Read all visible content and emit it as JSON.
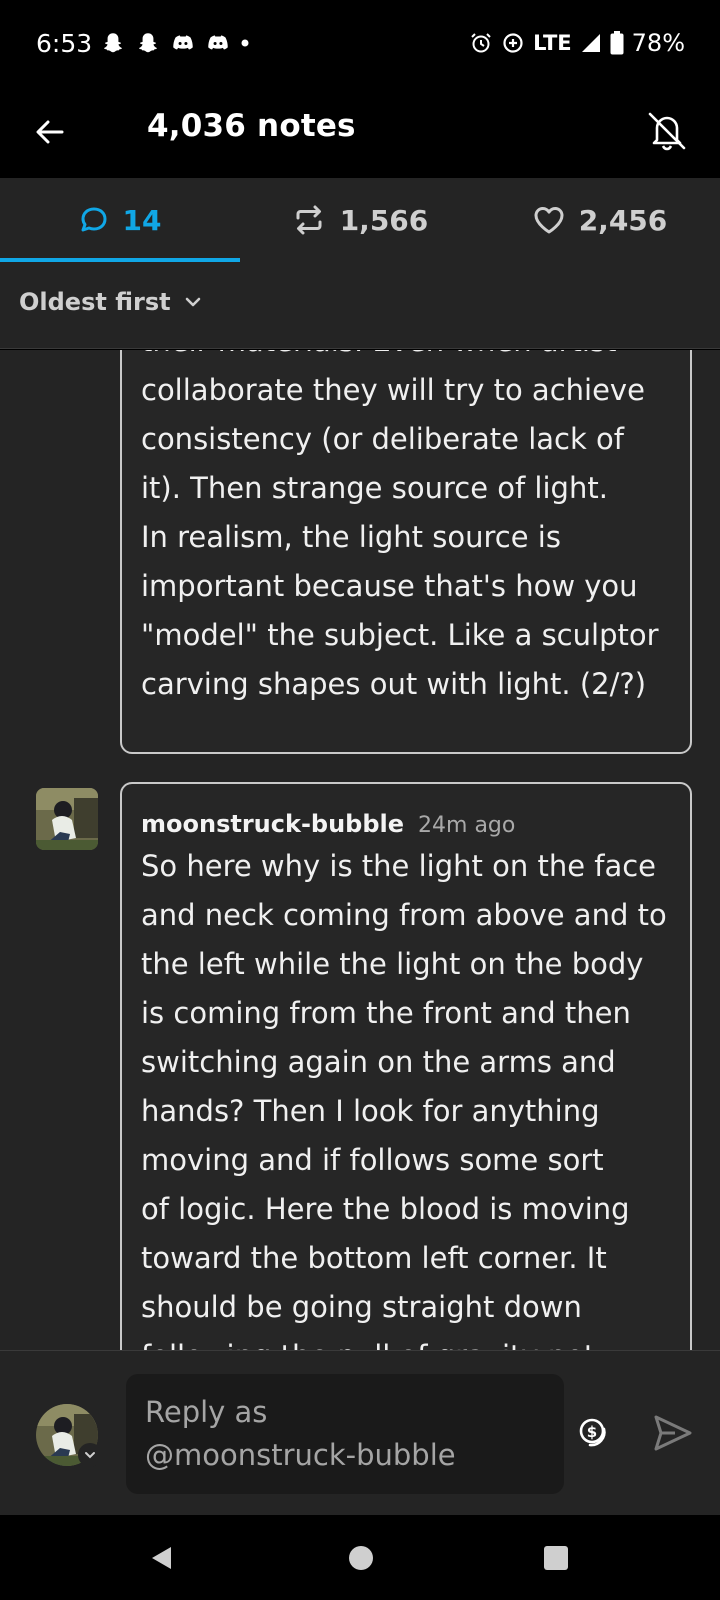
{
  "status_bar": {
    "time": "6:53",
    "left_icons": [
      "snapchat-icon",
      "snapchat-icon",
      "discord-icon",
      "discord-icon",
      "dot-icon"
    ],
    "right_icons": [
      "alarm-icon",
      "data-saver-icon",
      "signal-icon",
      "battery-icon"
    ],
    "network": "LTE",
    "battery": "78%"
  },
  "header": {
    "title": "4,036 notes"
  },
  "tabs": [
    {
      "icon": "comment-icon",
      "count": "14"
    },
    {
      "icon": "reblog-icon",
      "count": "1,566"
    },
    {
      "icon": "heart-icon",
      "count": "2,456"
    }
  ],
  "sort": {
    "label": "Oldest first"
  },
  "notes": [
    {
      "text": "their materials. Even when artist\ncollaborate they will try to achieve\nconsistency (or deliberate lack of\nit). Then strange source of light.\nIn realism, the light source is\nimportant because that's how you\n\"model\" the subject. Like a sculptor\ncarving shapes out with light. (2/?)"
    },
    {
      "user": "moonstruck-bubble",
      "time": "24m ago",
      "text": "So here why is the light on the face\nand neck coming from above and to\nthe left while the light on the body\nis coming from the front and then\nswitching again on the arms and\nhands? Then I look for anything\nmoving and if follows some sort\nof logic. Here the blood is moving\ntoward the bottom left corner. It\nshould be going straight down\nfollowing the pull of gravity not"
    }
  ],
  "reply": {
    "placeholder": "Reply as\n@moonstruck-bubble"
  },
  "colors": {
    "accent": "#10a7e6",
    "background": "#242424",
    "text": "#f0f0f0"
  }
}
